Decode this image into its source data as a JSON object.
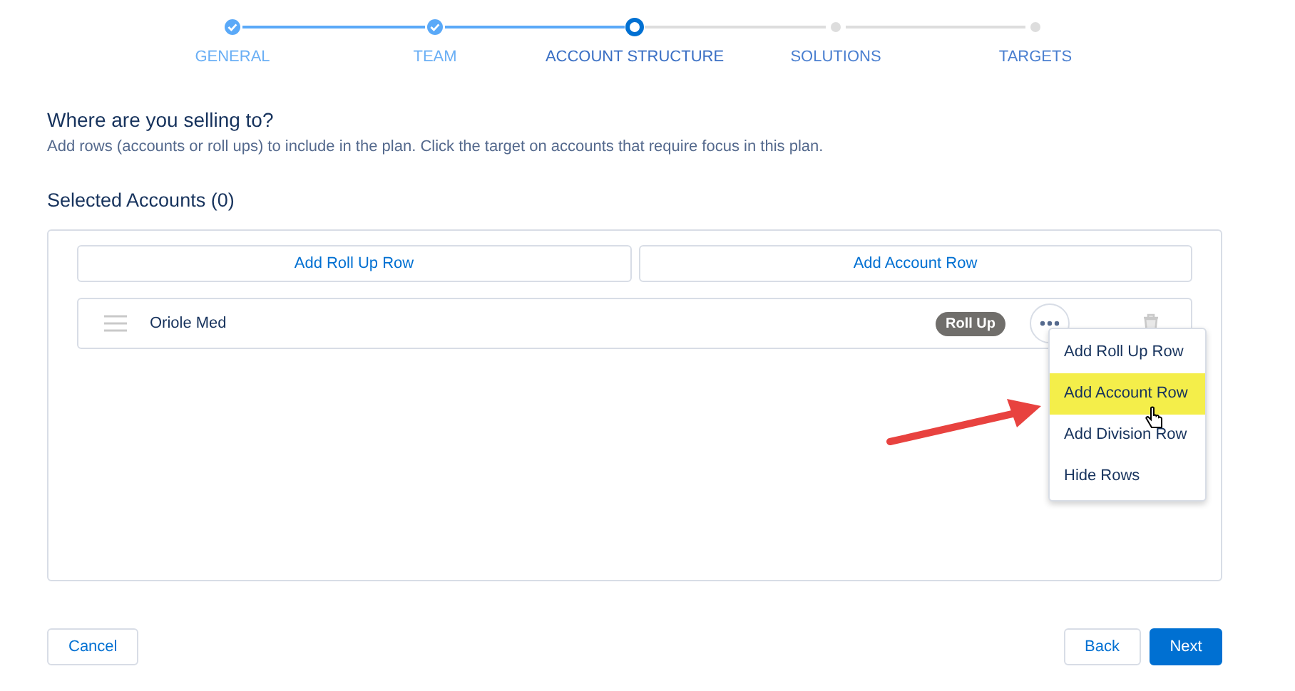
{
  "steps": [
    {
      "label": "GENERAL",
      "completed": true,
      "current": false
    },
    {
      "label": "TEAM",
      "completed": true,
      "current": false
    },
    {
      "label": "ACCOUNT STRUCTURE",
      "completed": false,
      "current": true
    },
    {
      "label": "SOLUTIONS",
      "completed": false,
      "current": false
    },
    {
      "label": "TARGETS",
      "completed": false,
      "current": false
    }
  ],
  "heading": "Where are you selling to?",
  "description": "Add rows (accounts or roll ups) to include in the plan. Click the target on accounts that require focus in this plan.",
  "selected_accounts_title": "Selected Accounts (0)",
  "add_buttons": [
    "Add Roll Up Row",
    "Add Account Row"
  ],
  "rows": [
    {
      "name": "Oriole Med",
      "badge": "Roll Up"
    }
  ],
  "menu": [
    {
      "label": "Add Roll Up Row",
      "selected": false
    },
    {
      "label": "Add Account Row",
      "selected": true
    },
    {
      "label": "Add Division Row",
      "selected": false
    },
    {
      "label": "Hide Rows",
      "selected": false
    }
  ],
  "footer": {
    "cancel": "Cancel",
    "back": "Back",
    "next": "Next"
  }
}
